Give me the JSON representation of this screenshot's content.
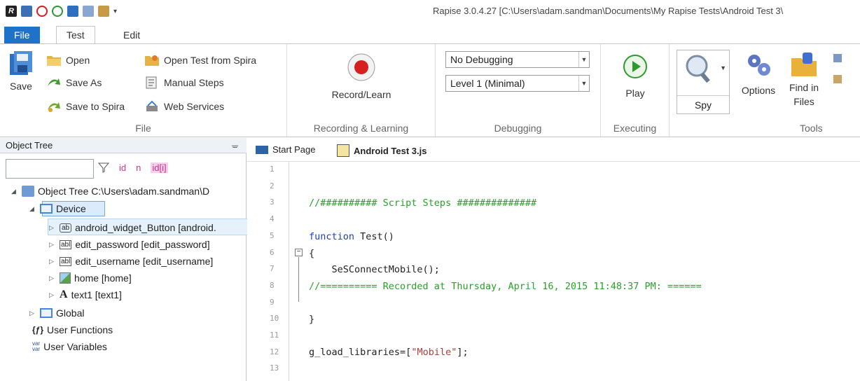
{
  "window": {
    "title": "Rapise 3.0.4.27 [C:\\Users\\adam.sandman\\Documents\\My Rapise Tests\\Android Test 3\\"
  },
  "tabs": [
    {
      "label": "File"
    },
    {
      "label": "Test"
    },
    {
      "label": "Edit"
    }
  ],
  "ribbon": {
    "file_group": {
      "label": "File",
      "save": "Save",
      "open": "Open",
      "save_as": "Save As",
      "save_to_spira": "Save to Spira",
      "open_from_spira": "Open Test from Spira",
      "manual_steps": "Manual Steps",
      "web_services": "Web Services"
    },
    "recording_group": {
      "label": "Recording & Learning",
      "record": "Record/Learn"
    },
    "debugging_group": {
      "label": "Debugging",
      "mode_value": "No Debugging",
      "level_value": "Level 1 (Minimal)"
    },
    "executing_group": {
      "label": "Executing",
      "play": "Play"
    },
    "tools_group": {
      "label": "Tools",
      "spy": "Spy",
      "options": "Options",
      "find_in_files_line1": "Find in",
      "find_in_files_line2": "Files"
    }
  },
  "object_tree": {
    "panel_title": "Object Tree",
    "filter_value": "",
    "filter_id": "id",
    "filter_n": "n",
    "filter_idx": "id",
    "root": "Object Tree C:\\Users\\adam.sandman\\D",
    "device": "Device",
    "items": [
      {
        "badge": "ab",
        "label": "android_widget_Button [android."
      },
      {
        "badge": "abl",
        "label": "edit_password [edit_password]"
      },
      {
        "badge": "abl",
        "label": "edit_username [edit_username]"
      },
      {
        "badge": "",
        "label": "home [home]"
      },
      {
        "badge": "A",
        "label": "text1 [text1]"
      }
    ],
    "global": "Global",
    "user_functions": "User Functions",
    "user_variables": "User Variables"
  },
  "editor": {
    "tabs": [
      {
        "label": "Start Page"
      },
      {
        "label": "Android Test 3.js"
      }
    ],
    "line_numbers": [
      "1",
      "2",
      "3",
      "4",
      "5",
      "6",
      "7",
      "8",
      "9",
      "10",
      "11",
      "12",
      "13"
    ],
    "code": {
      "line3": "//########## Script Steps ##############",
      "line5_kw": "function",
      "line5_rest": " Test()",
      "line6": "{",
      "line7": "    SeSConnectMobile();",
      "line8": "//========== Recorded at Thursday, April 16, 2015 11:48:37 PM: ======",
      "line10": "}",
      "line12_a": "g_load_libraries=[",
      "line12_str": "\"Mobile\"",
      "line12_b": "];"
    }
  },
  "colors": {
    "file_tab": "#1e72c8",
    "comment": "#2aa02a",
    "keyword": "#1f3fb4",
    "string": "#b33c3c",
    "record_red": "#d62020",
    "play_green": "#2e9a2e"
  }
}
